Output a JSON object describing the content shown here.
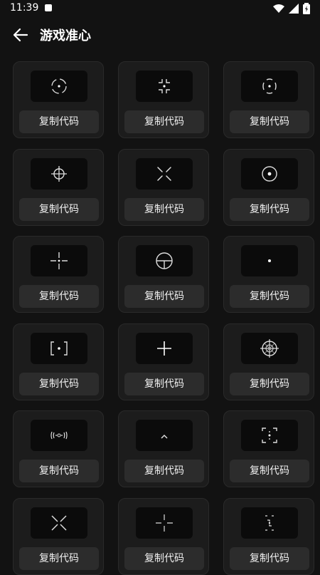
{
  "status_bar": {
    "time": "11:39"
  },
  "header": {
    "title": "游戏准心"
  },
  "copy_label": "复制代码",
  "crosshairs": [
    {
      "icon": "dashed-circle-dot-crosshair-icon"
    },
    {
      "icon": "corner-bracket-dot-crosshair-icon"
    },
    {
      "icon": "bracket-dot-crosshair-icon"
    },
    {
      "icon": "circle-cross-crosshair-icon"
    },
    {
      "icon": "diagonal-x-crosshair-icon"
    },
    {
      "icon": "circle-dot-crosshair-icon"
    },
    {
      "icon": "gapped-cross-dot-crosshair-icon"
    },
    {
      "icon": "circle-t-crosshair-icon"
    },
    {
      "icon": "dot-crosshair-icon"
    },
    {
      "icon": "square-bracket-dot-crosshair-icon"
    },
    {
      "icon": "plus-crosshair-icon"
    },
    {
      "icon": "sniper-scope-crosshair-icon"
    },
    {
      "icon": "wave-arc-crosshair-icon"
    },
    {
      "icon": "chevron-up-crosshair-icon"
    },
    {
      "icon": "corner-frame-dot-crosshair-icon"
    },
    {
      "icon": "large-x-crosshair-icon"
    },
    {
      "icon": "thin-cross-crosshair-icon"
    },
    {
      "icon": "stepped-bracket-crosshair-icon"
    }
  ]
}
